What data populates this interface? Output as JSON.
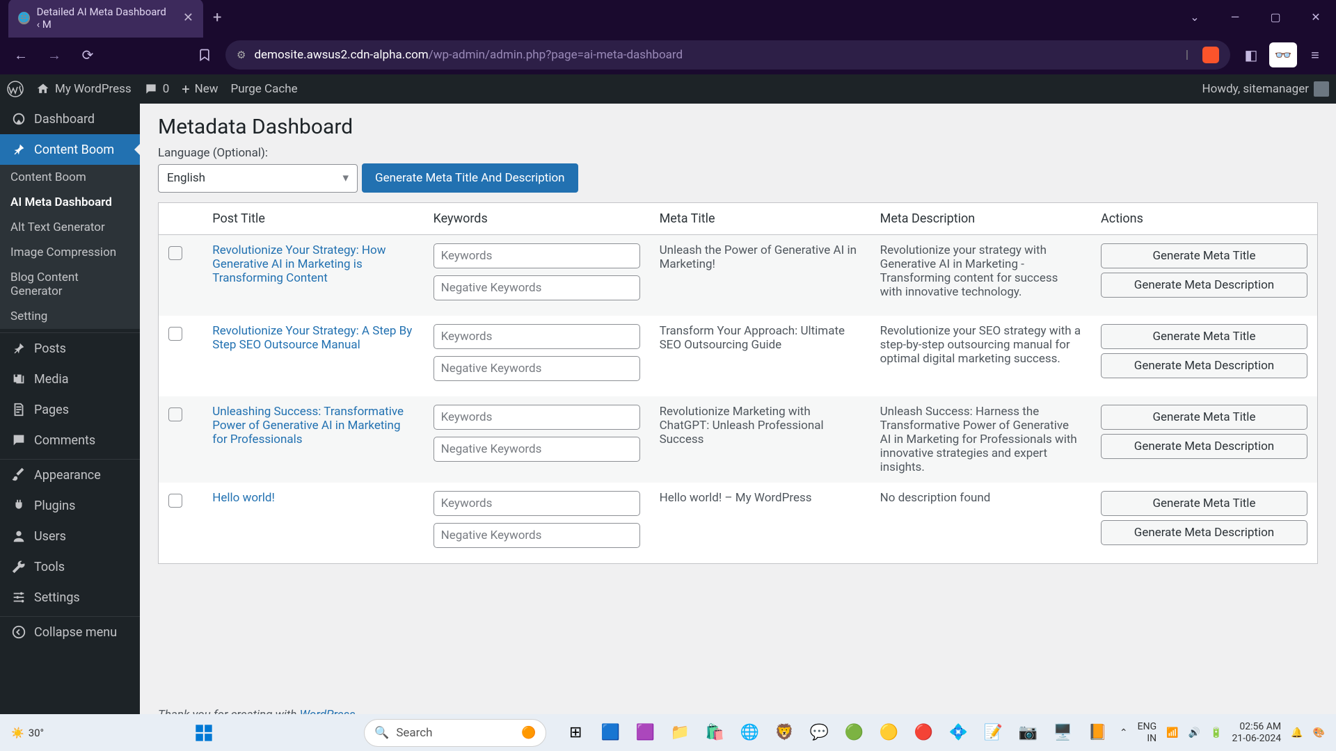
{
  "browser": {
    "tab_title": "Detailed AI Meta Dashboard ‹ M",
    "url_domain": "demosite.awsus2.cdn-alpha.com",
    "url_path": "/wp-admin/admin.php?page=ai-meta-dashboard"
  },
  "adminbar": {
    "site_name": "My WordPress",
    "comments": "0",
    "new_label": "New",
    "purge_label": "Purge Cache",
    "howdy": "Howdy, sitemanager"
  },
  "sidebar": {
    "items": [
      {
        "label": "Dashboard"
      },
      {
        "label": "Content Boom"
      },
      {
        "label": "Posts"
      },
      {
        "label": "Media"
      },
      {
        "label": "Pages"
      },
      {
        "label": "Comments"
      },
      {
        "label": "Appearance"
      },
      {
        "label": "Plugins"
      },
      {
        "label": "Users"
      },
      {
        "label": "Tools"
      },
      {
        "label": "Settings"
      },
      {
        "label": "Collapse menu"
      }
    ],
    "submenu": [
      {
        "label": "Content Boom"
      },
      {
        "label": "AI Meta Dashboard"
      },
      {
        "label": "Alt Text Generator"
      },
      {
        "label": "Image Compression"
      },
      {
        "label": "Blog Content Generator"
      },
      {
        "label": "Setting"
      }
    ]
  },
  "page": {
    "title": "Metadata Dashboard",
    "lang_label": "Language (Optional):",
    "lang_value": "English",
    "gen_button": "Generate Meta Title And Description"
  },
  "table": {
    "headers": {
      "post_title": "Post Title",
      "keywords": "Keywords",
      "meta_title": "Meta Title",
      "meta_desc": "Meta Description",
      "actions": "Actions"
    },
    "placeholders": {
      "keywords": "Keywords",
      "neg_keywords": "Negative Keywords"
    },
    "action_labels": {
      "gen_title": "Generate Meta Title",
      "gen_desc": "Generate Meta Description"
    },
    "rows": [
      {
        "title": "Revolutionize Your Strategy: How Generative AI in Marketing is Transforming Content",
        "meta_title": "Unleash the Power of Generative AI in Marketing!",
        "meta_desc": "Revolutionize your strategy with Generative AI in Marketing - Transforming content for success with innovative technology."
      },
      {
        "title": "Revolutionize Your Strategy: A Step By Step SEO Outsource Manual",
        "meta_title": "Transform Your Approach: Ultimate SEO Outsourcing Guide",
        "meta_desc": "Revolutionize your SEO strategy with a step-by-step outsourcing manual for optimal digital marketing success."
      },
      {
        "title": "Unleashing Success: Transformative Power of Generative AI in Marketing for Professionals",
        "meta_title": "Revolutionize Marketing with ChatGPT: Unleash Professional Success",
        "meta_desc": "Unleash Success: Harness the Transformative Power of Generative AI in Marketing for Professionals with innovative strategies and expert insights."
      },
      {
        "title": "Hello world!",
        "meta_title": "Hello world! – My WordPress",
        "meta_desc": "No description found"
      }
    ]
  },
  "footer": {
    "prefix": "Thank you for creating with ",
    "link": "WordPress"
  },
  "taskbar": {
    "weather": "30°",
    "search": "Search",
    "lang1": "ENG",
    "lang2": "IN",
    "time": "02:56 AM",
    "date": "21-06-2024"
  }
}
